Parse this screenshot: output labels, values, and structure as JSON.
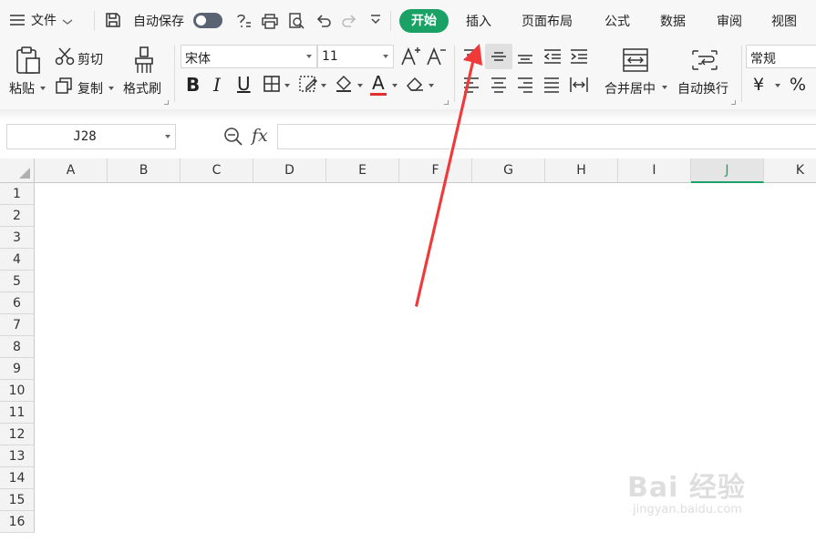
{
  "menubar": {
    "file_label": "文件",
    "autosave_label": "自动保存",
    "tabs": [
      "开始",
      "插入",
      "页面布局",
      "公式",
      "数据",
      "审阅",
      "视图"
    ]
  },
  "ribbon": {
    "paste_label": "粘贴",
    "cut_label": "剪切",
    "copy_label": "复制",
    "format_painter_label": "格式刷",
    "font_name": "宋体",
    "font_size": "11",
    "merge_center_label": "合并居中",
    "wrap_text_label": "自动换行",
    "number_format": "常规",
    "currency_symbol": "¥",
    "percent_symbol": "%",
    "bold": "B",
    "italic": "I",
    "underline": "U",
    "font_color_letter": "A",
    "font_color": "#e03030"
  },
  "formula_bar": {
    "cell_ref": "J28",
    "fx_label": "fx",
    "formula": ""
  },
  "grid": {
    "columns": [
      "A",
      "B",
      "C",
      "D",
      "E",
      "F",
      "G",
      "H",
      "I",
      "J",
      "K"
    ],
    "selected_column": "J",
    "rows": [
      "1",
      "2",
      "3",
      "4",
      "5",
      "6",
      "7",
      "8",
      "9",
      "10",
      "11",
      "12",
      "13",
      "14",
      "15",
      "16"
    ]
  },
  "annotation": {
    "arrow_color": "#f03a3a",
    "points_to": "插入"
  },
  "watermark": {
    "main": "Bai 经验",
    "sub": "jingyan.baidu.com"
  },
  "colors": {
    "accent": "#1aa266",
    "arrow": "#f03a3a"
  }
}
